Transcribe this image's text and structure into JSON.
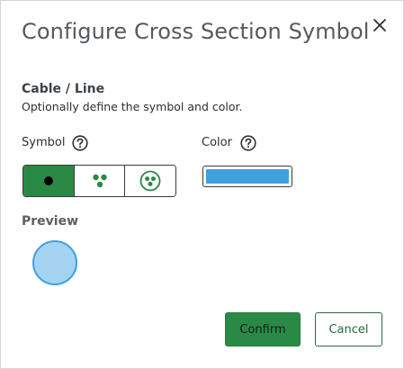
{
  "dialog": {
    "title": "Configure Cross Section Symbol",
    "close_icon": "close-icon"
  },
  "section": {
    "heading": "Cable / Line",
    "description": "Optionally define the symbol and color."
  },
  "symbol": {
    "label": "Symbol",
    "help_icon": "question-circle-icon",
    "options": [
      {
        "name": "single-dot",
        "icon": "single-dot-icon",
        "selected": true
      },
      {
        "name": "three-dots",
        "icon": "three-dots-icon",
        "selected": false
      },
      {
        "name": "three-dots-in-circle",
        "icon": "three-dots-in-circle-icon",
        "selected": false
      }
    ]
  },
  "color": {
    "label": "Color",
    "help_icon": "question-circle-icon",
    "value": "#3fa0e0"
  },
  "preview": {
    "heading": "Preview",
    "fill": "#a5d3f2",
    "stroke": "#3f9fe2"
  },
  "actions": {
    "confirm_label": "Confirm",
    "cancel_label": "Cancel"
  },
  "colors": {
    "primary_green": "#2a8a45",
    "selected_green": "#2a8a45",
    "icon_green": "#2a8a45"
  }
}
